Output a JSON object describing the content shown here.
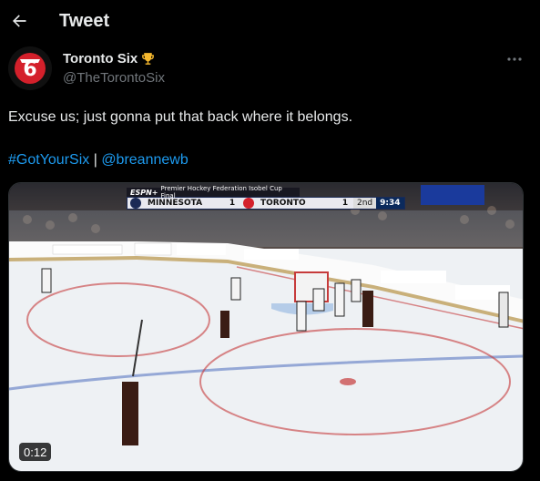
{
  "header": {
    "title": "Tweet"
  },
  "author": {
    "name": "Toronto Six",
    "handle": "@TheTorontoSix",
    "badge_icon": "trophy-icon"
  },
  "tweet": {
    "text": "Excuse us; just gonna put that back where it belongs.",
    "hashtag": "#GotYourSix",
    "separator": "|",
    "mention": "@breannewb"
  },
  "media": {
    "duration": "0:12",
    "scoreboard": {
      "network": "ESPN+",
      "event": "Premier Hockey Federation Isobel Cup Final",
      "away_team": "MINNESOTA",
      "away_score": "1",
      "home_team": "TORONTO",
      "home_score": "1",
      "period": "2nd",
      "clock": "9:34"
    }
  },
  "colors": {
    "background": "#000000",
    "text": "#e7e9ea",
    "secondary": "#71767b",
    "link": "#1d9bf0"
  }
}
